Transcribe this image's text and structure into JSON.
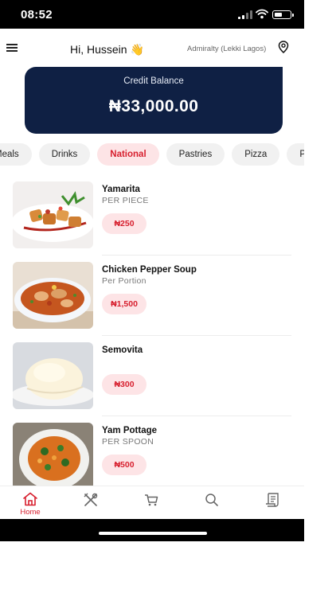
{
  "status_bar": {
    "time": "08:52"
  },
  "header": {
    "greeting": "Hi, Hussein 👋",
    "location": "Admiralty (Lekki Lagos)"
  },
  "credit": {
    "label": "Credit Balance",
    "amount": "₦33,000.00"
  },
  "categories": [
    {
      "label": "Meals",
      "active": false
    },
    {
      "label": "Drinks",
      "active": false
    },
    {
      "label": "National",
      "active": true
    },
    {
      "label": "Pastries",
      "active": false
    },
    {
      "label": "Pizza",
      "active": false
    },
    {
      "label": "Protein",
      "active": false
    }
  ],
  "foods": [
    {
      "name": "Yamarita",
      "unit": "PER PIECE",
      "price": "₦250"
    },
    {
      "name": "Chicken Pepper Soup",
      "unit": "Per Portion",
      "price": "₦1,500"
    },
    {
      "name": "Semovita",
      "unit": "",
      "price": "₦300"
    },
    {
      "name": "Yam Pottage",
      "unit": "PER SPOON",
      "price": "₦500"
    }
  ],
  "tabs": [
    {
      "name": "home-icon",
      "label": "Home",
      "active": true
    },
    {
      "name": "utensils-icon",
      "label": "",
      "active": false
    },
    {
      "name": "cart-icon",
      "label": "",
      "active": false
    },
    {
      "name": "search-icon",
      "label": "",
      "active": false
    },
    {
      "name": "receipt-icon",
      "label": "",
      "active": false
    }
  ],
  "colors": {
    "accent": "#d71f2e",
    "accent_light": "#fde4e6",
    "card": "#0f2044"
  }
}
